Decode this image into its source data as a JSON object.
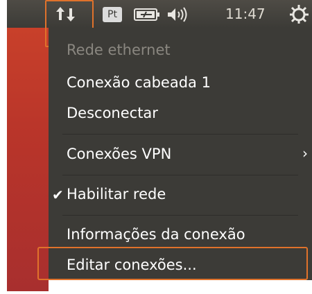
{
  "panel": {
    "keyboard_layout": "Pt",
    "clock": "11:47",
    "icons": {
      "network": "network-updown-icon",
      "battery": "battery-icon",
      "volume": "volume-icon",
      "power": "power-gear-icon"
    }
  },
  "menu": {
    "items": [
      {
        "label": "Rede ethernet",
        "enabled": false
      },
      {
        "label": "Conexão cabeada 1",
        "enabled": true
      },
      {
        "label": "Desconectar",
        "enabled": true
      },
      {
        "label": "Conexões VPN",
        "enabled": true,
        "submenu": true,
        "arrow": "›"
      },
      {
        "label": "Habilitar rede",
        "enabled": true,
        "checked": true,
        "check_glyph": "✔"
      },
      {
        "label": "Informações da conexão",
        "enabled": true
      },
      {
        "label": "Editar conexões...",
        "enabled": true,
        "highlighted": true
      }
    ]
  },
  "colors": {
    "panel_bg": "#3c3b37",
    "menu_bg": "#3c3b37",
    "highlight_border": "#e0722b",
    "wallpaper": "#b9352a",
    "disabled_text": "#8a8780"
  }
}
